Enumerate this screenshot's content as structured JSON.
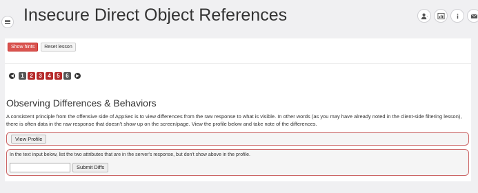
{
  "header": {
    "title": "Insecure Direct Object References",
    "icons": [
      "menu-icon",
      "user-icon",
      "chart-icon",
      "info-icon",
      "envelope-icon"
    ]
  },
  "toolbar": {
    "show_hints_label": "Show hints",
    "reset_lesson_label": "Reset lesson"
  },
  "pager": {
    "prev_icon": "arrow-left-icon",
    "next_icon": "arrow-right-icon",
    "pages": [
      {
        "label": "1",
        "status": "complete"
      },
      {
        "label": "2",
        "status": "incomplete"
      },
      {
        "label": "3",
        "status": "incomplete"
      },
      {
        "label": "4",
        "status": "incomplete"
      },
      {
        "label": "5",
        "status": "incomplete"
      },
      {
        "label": "6",
        "status": "complete"
      }
    ]
  },
  "content": {
    "heading": "Observing Differences & Behaviors",
    "intro": "A consistent principle from the offensive side of AppSec is to view differences from the raw response to what is visible. In other words (as you may have already noted in the client-side filtering lesson), there is often data in the raw response that doesn't show up on the screen/page. View the profile below and take note of the differences.",
    "view_profile_label": "View Profile",
    "instruction": "In the text input below, list the two attributes that are in the server's response, but don't show above in the profile.",
    "diff_input_value": "",
    "submit_label": "Submit Diffs"
  },
  "colors": {
    "danger": "#d9534f",
    "page_incomplete": "#b52a2a",
    "page_complete": "#555555",
    "box_border": "#cc6666"
  }
}
